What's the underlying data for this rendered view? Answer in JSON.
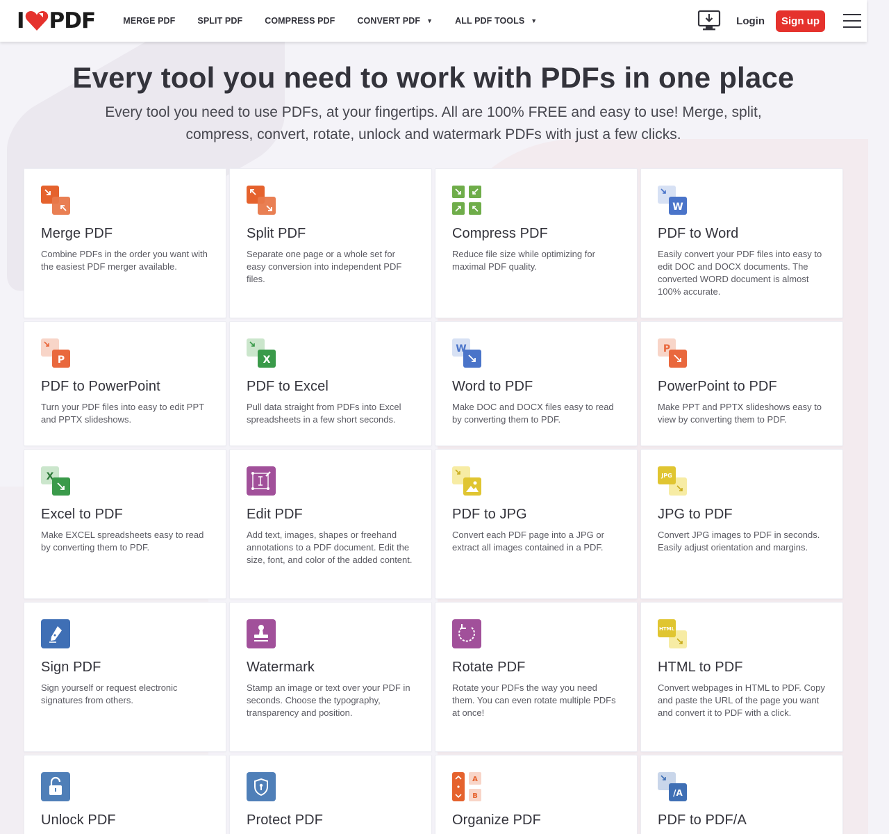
{
  "header": {
    "logo": {
      "prefix": "I",
      "suffix": "PDF"
    },
    "nav": [
      {
        "label": "MERGE PDF",
        "dropdown": false
      },
      {
        "label": "SPLIT PDF",
        "dropdown": false
      },
      {
        "label": "COMPRESS PDF",
        "dropdown": false
      },
      {
        "label": "CONVERT PDF",
        "dropdown": true
      },
      {
        "label": "ALL PDF TOOLS",
        "dropdown": true
      }
    ],
    "login": "Login",
    "signup": "Sign up",
    "icons": {
      "desktop": "desktop-download-icon",
      "menu": "hamburger-menu-icon"
    }
  },
  "hero": {
    "title": "Every tool you need to work with PDFs in one place",
    "subtitle": "Every tool you need to use PDFs, at your fingertips. All are 100% FREE and easy to use! Merge, split, compress, convert, rotate, unlock and watermark PDFs with just a few clicks."
  },
  "colors": {
    "brand_red": "#e5322d",
    "merge": "#e5622d",
    "compress": "#6fad4a",
    "word": "#4a74c9",
    "powerpoint": "#e9683d",
    "excel": "#3a9a4a",
    "edit": "#a1509a",
    "jpg": "#e0c531",
    "sign": "#3f6fb5",
    "protect": "#4f7fb8"
  },
  "tools": [
    {
      "title": "Merge PDF",
      "desc": "Combine PDFs in the order you want with the easiest PDF merger available.",
      "icon": "merge-icon"
    },
    {
      "title": "Split PDF",
      "desc": "Separate one page or a whole set for easy conversion into independent PDF files.",
      "icon": "split-icon"
    },
    {
      "title": "Compress PDF",
      "desc": "Reduce file size while optimizing for maximal PDF quality.",
      "icon": "compress-icon"
    },
    {
      "title": "PDF to Word",
      "desc": "Easily convert your PDF files into easy to edit DOC and DOCX documents. The converted WORD document is almost 100% accurate.",
      "icon": "pdf-to-word-icon"
    },
    {
      "title": "PDF to PowerPoint",
      "desc": "Turn your PDF files into easy to edit PPT and PPTX slideshows.",
      "icon": "pdf-to-powerpoint-icon"
    },
    {
      "title": "PDF to Excel",
      "desc": "Pull data straight from PDFs into Excel spreadsheets in a few short seconds.",
      "icon": "pdf-to-excel-icon"
    },
    {
      "title": "Word to PDF",
      "desc": "Make DOC and DOCX files easy to read by converting them to PDF.",
      "icon": "word-to-pdf-icon"
    },
    {
      "title": "PowerPoint to PDF",
      "desc": "Make PPT and PPTX slideshows easy to view by converting them to PDF.",
      "icon": "powerpoint-to-pdf-icon"
    },
    {
      "title": "Excel to PDF",
      "desc": "Make EXCEL spreadsheets easy to read by converting them to PDF.",
      "icon": "excel-to-pdf-icon"
    },
    {
      "title": "Edit PDF",
      "desc": "Add text, images, shapes or freehand annotations to a PDF document. Edit the size, font, and color of the added content.",
      "icon": "edit-pdf-icon"
    },
    {
      "title": "PDF to JPG",
      "desc": "Convert each PDF page into a JPG or extract all images contained in a PDF.",
      "icon": "pdf-to-jpg-icon"
    },
    {
      "title": "JPG to PDF",
      "desc": "Convert JPG images to PDF in seconds. Easily adjust orientation and margins.",
      "icon": "jpg-to-pdf-icon"
    },
    {
      "title": "Sign PDF",
      "desc": "Sign yourself or request electronic signatures from others.",
      "icon": "sign-pdf-icon"
    },
    {
      "title": "Watermark",
      "desc": "Stamp an image or text over your PDF in seconds. Choose the typography, transparency and position.",
      "icon": "watermark-icon"
    },
    {
      "title": "Rotate PDF",
      "desc": "Rotate your PDFs the way you need them. You can even rotate multiple PDFs at once!",
      "icon": "rotate-pdf-icon"
    },
    {
      "title": "HTML to PDF",
      "desc": "Convert webpages in HTML to PDF. Copy and paste the URL of the page you want and convert it to PDF with a click.",
      "icon": "html-to-pdf-icon"
    },
    {
      "title": "Unlock PDF",
      "desc": "",
      "icon": "unlock-pdf-icon"
    },
    {
      "title": "Protect PDF",
      "desc": "",
      "icon": "protect-pdf-icon"
    },
    {
      "title": "Organize PDF",
      "desc": "",
      "icon": "organize-pdf-icon"
    },
    {
      "title": "PDF to PDF/A",
      "desc": "",
      "icon": "pdf-to-pdfa-icon"
    }
  ],
  "icon_labels": {
    "word": "W",
    "powerpoint": "P",
    "excel": "X",
    "jpg": "JPG",
    "html": "HTML",
    "pdfa": "/A",
    "organize_a": "A",
    "organize_b": "B"
  }
}
